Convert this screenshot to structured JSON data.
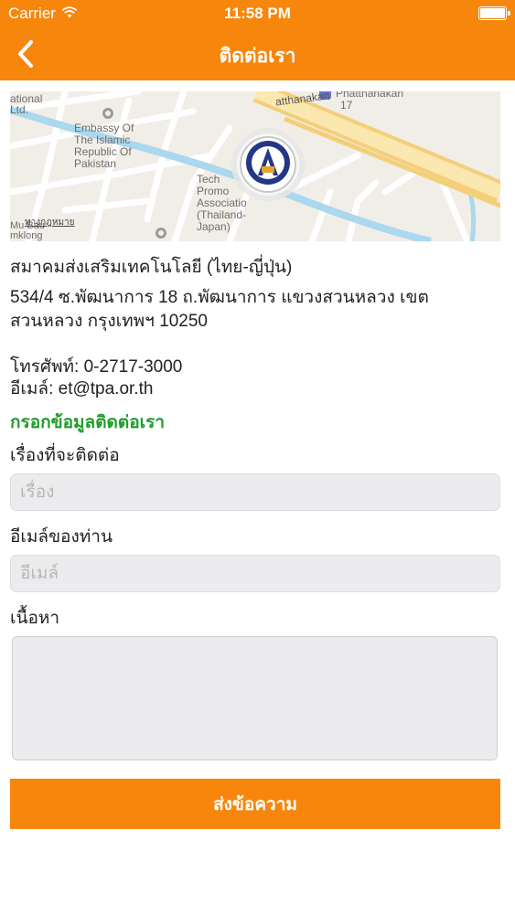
{
  "status_bar": {
    "carrier": "Carrier",
    "time": "11:58 PM",
    "wifi_icon": "wifi-icon",
    "battery_icon": "battery-icon"
  },
  "nav": {
    "title": "ติดต่อเรา",
    "back_icon": "chevron-left-icon"
  },
  "map": {
    "labels": {
      "national": "ational",
      "ltd": "Ltd.",
      "phatthanakan_top": "atthanakan",
      "phatthanakan_poi": "Phatthanakan",
      "poi_number": "17",
      "embassy": "Embassy Of\nThe Islamic\nRepublic Of\nPakistan",
      "tech": "Tech\nPromo\nAssociatio\n(Thailand-\nJapan)",
      "bottom_left": "Mu Bau\nmklong"
    },
    "legal_link": "ทางกฎหมาย",
    "marker_icon": "organization-logo-marker"
  },
  "contact": {
    "org_name": "สมาคมส่งเสริมเทคโนโลยี (ไทย-ญี่ปุ่น)",
    "address": "534/4 ซ.พัฒนาการ 18 ถ.พัฒนาการ แขวงสวนหลวง เขตสวนหลวง กรุงเทพฯ 10250",
    "phone": "โทรศัพท์: 0-2717-3000",
    "email": "อีเมล์: et@tpa.or.th"
  },
  "form": {
    "section_title": "กรอกข้อมูลติดต่อเรา",
    "subject_label": "เรื่องที่จะติดต่อ",
    "subject_placeholder": "เรื่อง",
    "subject_value": "",
    "email_label": "อีเมล์ของท่าน",
    "email_placeholder": "อีเมล์",
    "email_value": "",
    "message_label": "เนื้อหา",
    "message_value": "",
    "submit_label": "ส่งข้อความ"
  },
  "colors": {
    "brand_orange": "#f7860d",
    "section_green": "#1f9d2b"
  }
}
